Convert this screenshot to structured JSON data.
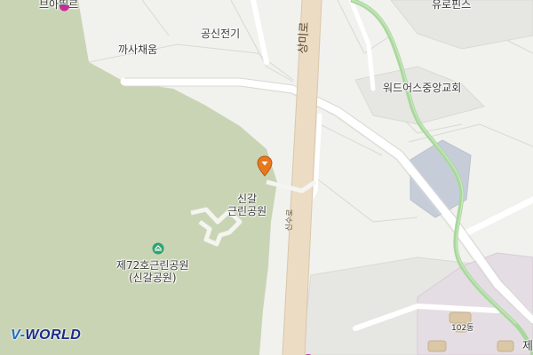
{
  "map": {
    "labels": {
      "top_shop": "브아뛰르",
      "top_right": "유로핀스",
      "gongsin": "공신전기",
      "kkasa": "까사채움",
      "church": "워드어스중앙교회",
      "park_small_line1": "신갈",
      "park_small_line2": "근린공원",
      "park_big_line1": "제72호근린공원",
      "park_big_line2": "(신갈공원)",
      "building": "102동",
      "edge_char": "제"
    },
    "roads": {
      "main_road": "상미로",
      "side_road": "신수로"
    },
    "icons": [
      "location-pin-icon",
      "park-icon",
      "shop-icon"
    ],
    "colors": {
      "park": "#c9d4b4",
      "road_fill": "#ecdcc4",
      "stream": "#a8d89b",
      "pin": "#e8781e",
      "shop": "#cc2a9a"
    }
  },
  "branding": {
    "logo_text": "WORLD",
    "logo_prefix": "V-"
  }
}
